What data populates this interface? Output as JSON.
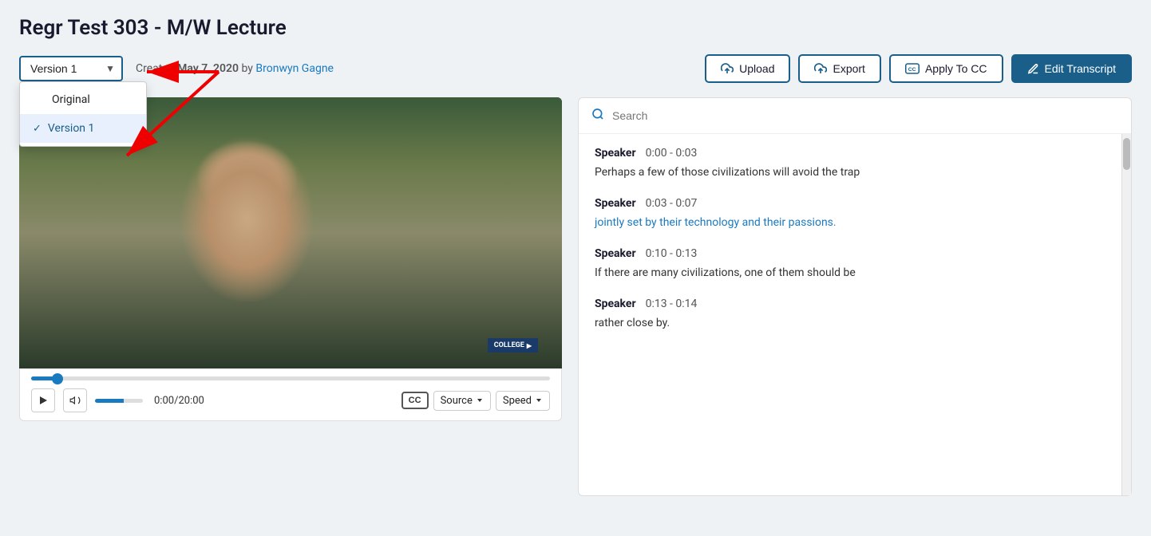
{
  "page": {
    "title": "Regr Test 303 - M/W Lecture"
  },
  "topbar": {
    "version_select_label": "Version 1",
    "created_label": "Created",
    "created_date": "May 7, 2020",
    "created_by": "by",
    "created_author": "Bronwyn Gagne",
    "upload_label": "Upload",
    "export_label": "Export",
    "apply_cc_label": "Apply To CC",
    "edit_transcript_label": "Edit Transcript"
  },
  "dropdown": {
    "options": [
      {
        "id": "original",
        "label": "Original",
        "selected": false
      },
      {
        "id": "version1",
        "label": "Version 1",
        "selected": true
      }
    ]
  },
  "video": {
    "time_current": "0:00",
    "time_total": "20:00",
    "college_label": "COLLEGE",
    "source_label": "Source",
    "speed_label": "Speed"
  },
  "search": {
    "placeholder": "Search"
  },
  "transcript": {
    "entries": [
      {
        "speaker": "Speaker",
        "time": "0:00 - 0:03",
        "text": "Perhaps a few of those civilizations will avoid the trap",
        "link": false
      },
      {
        "speaker": "Speaker",
        "time": "0:03 - 0:07",
        "text": "jointly set by their technology and their passions.",
        "link": true
      },
      {
        "speaker": "Speaker",
        "time": "0:10 - 0:13",
        "text": "If there are many civilizations, one of them should be",
        "link": false
      },
      {
        "speaker": "Speaker",
        "time": "0:13 - 0:14",
        "text": "rather close by.",
        "link": false
      }
    ]
  }
}
